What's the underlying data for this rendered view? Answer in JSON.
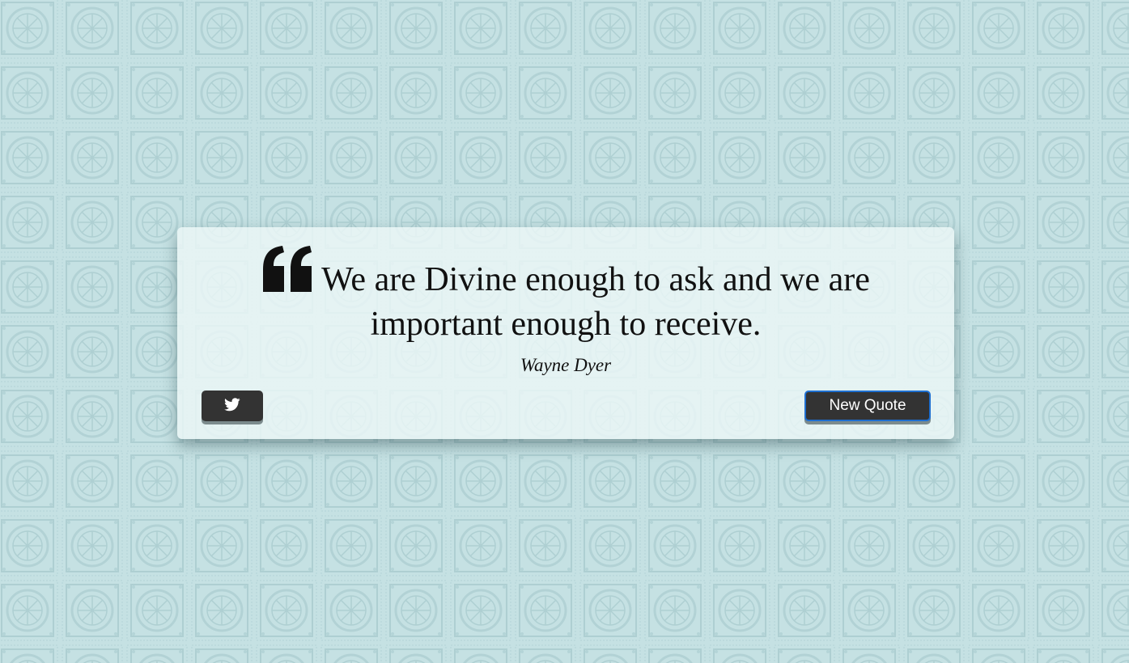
{
  "quote": {
    "text": "We are Divine enough to ask and we are important enough to receive.",
    "author": "Wayne Dyer",
    "quote_icon": "left-double-quote-icon"
  },
  "actions": {
    "tweet_icon": "twitter-icon",
    "new_quote_label": "New Quote"
  },
  "colors": {
    "background": "#c5e1e3",
    "button": "#333333",
    "button_text": "#ffffff",
    "focus_ring": "#1e6fd0"
  }
}
